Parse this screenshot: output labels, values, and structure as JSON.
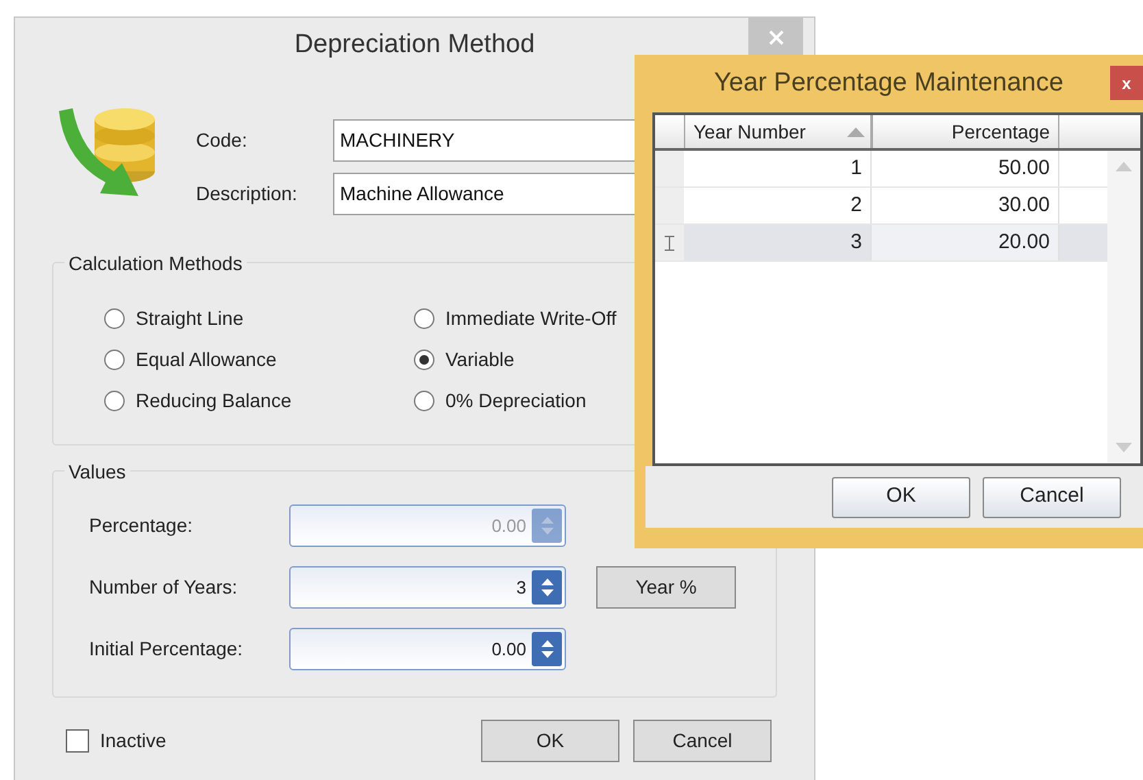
{
  "main_window": {
    "title": "Depreciation Method",
    "fields": [
      {
        "label": "Code:",
        "value": "MACHINERY"
      },
      {
        "label": "Description:",
        "value": "Machine Allowance"
      }
    ],
    "calculation_methods": {
      "title": "Calculation Methods",
      "options": [
        {
          "label": "Straight Line",
          "selected": false
        },
        {
          "label": "Equal Allowance",
          "selected": false
        },
        {
          "label": "Reducing Balance",
          "selected": false
        },
        {
          "label": "Immediate Write-Off",
          "selected": false
        },
        {
          "label": "Variable",
          "selected": true
        },
        {
          "label": "0% Depreciation",
          "selected": false
        }
      ]
    },
    "values": {
      "title": "Values",
      "spinners": [
        {
          "label": "Percentage:",
          "value": "0.00",
          "disabled": true
        },
        {
          "label": "Number of Years:",
          "value": "3",
          "disabled": false
        },
        {
          "label": "Initial Percentage:",
          "value": "0.00",
          "disabled": false
        }
      ],
      "year_button": "Year %"
    },
    "inactive": {
      "label": "Inactive",
      "checked": false
    },
    "buttons": [
      "OK",
      "Cancel"
    ]
  },
  "year_window": {
    "title": "Year Percentage Maintenance",
    "close": "x",
    "columns": [
      {
        "label": "Year Number",
        "sorted": true
      },
      {
        "label": "Percentage",
        "sorted": false
      }
    ],
    "rows": [
      {
        "cells": [
          "1",
          "50.00"
        ],
        "selected": false
      },
      {
        "cells": [
          "2",
          "30.00"
        ],
        "selected": false
      },
      {
        "cells": [
          "3",
          "20.00"
        ],
        "selected": true
      }
    ],
    "buttons": [
      "OK",
      "Cancel"
    ]
  }
}
